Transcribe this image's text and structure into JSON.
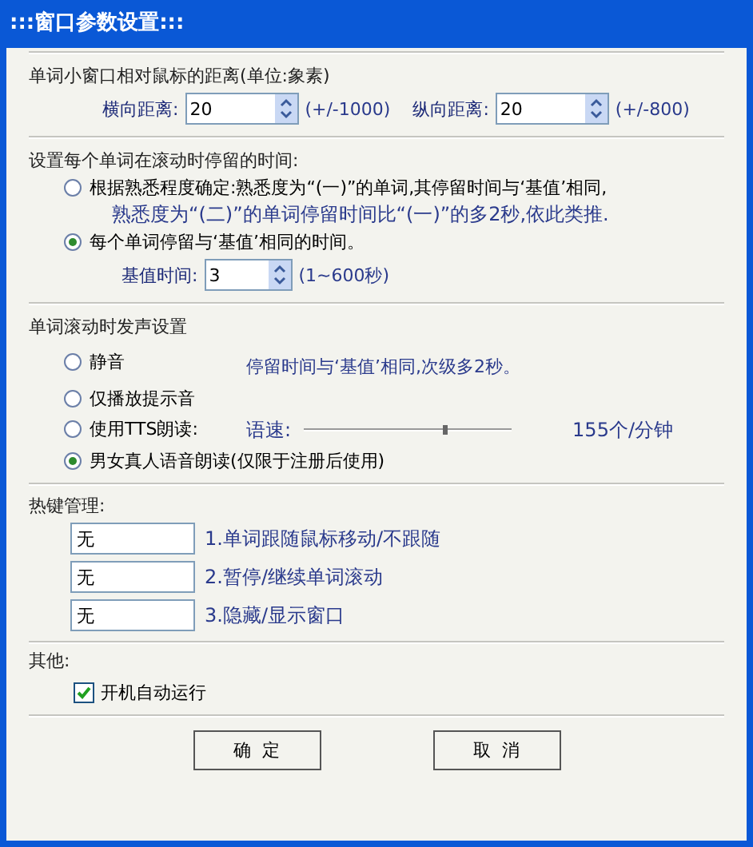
{
  "window": {
    "title": ":::窗口参数设置:::"
  },
  "distance": {
    "heading": "单词小窗口相对鼠标的距离(单位:象素)",
    "fields": [
      {
        "label": "横向距离:",
        "value": "20",
        "range": "(+/-1000)"
      },
      {
        "label": "纵向距离:",
        "value": "20",
        "range": "(+/-800)"
      }
    ]
  },
  "dwell": {
    "heading": "设置每个单词在滚动时停留的时间:",
    "options": [
      {
        "label": "根据熟悉程度确定:熟悉度为“(一)”的单词,其停留时间与‘基值’相同,",
        "note": "熟悉度为“(二)”的单词停留时间比“(一)”的多2秒,依此类推.",
        "selected": false
      },
      {
        "label": "每个单词停留与‘基值’相同的时间。",
        "selected": true
      }
    ],
    "base": {
      "label": "基值时间:",
      "value": "3",
      "range": "(1~600秒)"
    }
  },
  "sound": {
    "heading": "单词滚动时发声设置",
    "note": "停留时间与‘基值’相同,次级多2秒。",
    "options": [
      {
        "label": "静音",
        "selected": false
      },
      {
        "label": "仅播放提示音",
        "selected": false
      },
      {
        "label": "使用TTS朗读:",
        "selected": false
      },
      {
        "label": "男女真人语音朗读(仅限于注册后使用)",
        "selected": true
      }
    ],
    "rate": {
      "label": "语速:",
      "level": 0.68,
      "reading": "155个/分钟"
    }
  },
  "hotkeys": {
    "heading": "热键管理:",
    "items": [
      {
        "value": "无",
        "label": "1.单词跟随鼠标移动/不跟随"
      },
      {
        "value": "无",
        "label": "2.暂停/继续单词滚动"
      },
      {
        "value": "无",
        "label": "3.隐藏/显示窗口"
      }
    ]
  },
  "other": {
    "heading": "其他:",
    "checkbox": {
      "label": "开机自动运行",
      "checked": true
    }
  },
  "buttons": [
    "确  定",
    "取  消"
  ]
}
